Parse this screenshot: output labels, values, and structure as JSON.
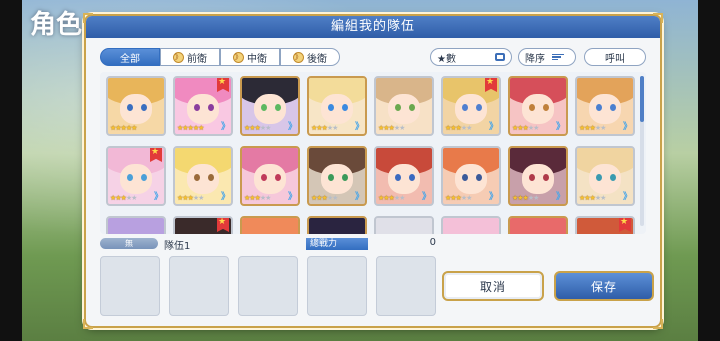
{
  "background": {
    "title_fragment": "角色"
  },
  "dialog": {
    "title": "編組我的隊伍"
  },
  "filters": {
    "tabs": [
      {
        "label": "全部",
        "active": true,
        "icon": ""
      },
      {
        "label": "前衛",
        "active": false,
        "icon": "position-icon"
      },
      {
        "label": "中衛",
        "active": false,
        "icon": "position-icon"
      },
      {
        "label": "後衛",
        "active": false,
        "icon": "position-icon"
      }
    ],
    "sort_field": "★數",
    "sort_order": "降序",
    "call_label": "呼叫"
  },
  "roster": {
    "rows": [
      [
        {
          "stars": 5,
          "fav": false,
          "rank": "",
          "hair": "#e8b55a",
          "eye": "#3a6ec0",
          "bg": "#f6d8a6"
        },
        {
          "stars": 5,
          "fav": true,
          "rank": "》",
          "hair": "#f08ac0",
          "eye": "#8a3d9e",
          "bg": "#f9c8e2"
        },
        {
          "stars": 3,
          "fav": false,
          "rank": "》",
          "hair": "#2c2a36",
          "eye": "#5cb860",
          "bg": "#d8c6e8"
        },
        {
          "stars": 3,
          "fav": false,
          "rank": "》",
          "hair": "#f3dc9a",
          "eye": "#3a8ae0",
          "bg": "#f7e5c6"
        },
        {
          "stars": 3,
          "fav": false,
          "rank": "",
          "hair": "#d9b58a",
          "eye": "#6aa84f",
          "bg": "#f7e1c6"
        },
        {
          "stars": 3,
          "fav": true,
          "rank": "》",
          "hair": "#e8c46a",
          "eye": "#4f7fd0",
          "bg": "#f2d4a4"
        },
        {
          "stars": 3,
          "fav": false,
          "rank": "》",
          "hair": "#d64f5a",
          "eye": "#c0803a",
          "bg": "#f6c4c4"
        },
        {
          "stars": 3,
          "fav": false,
          "rank": "》",
          "hair": "#e3a35a",
          "eye": "#4a7fd0",
          "bg": "#f7d6b0"
        }
      ],
      [
        {
          "stars": 3,
          "fav": true,
          "rank": "》",
          "hair": "#f2b8d6",
          "eye": "#4aa0d8",
          "bg": "#f6d2e6"
        },
        {
          "stars": 3,
          "fav": false,
          "rank": "》",
          "hair": "#f4d870",
          "eye": "#9a6a3a",
          "bg": "#fbe8b0"
        },
        {
          "stars": 3,
          "fav": false,
          "rank": "》",
          "hair": "#e47aa4",
          "eye": "#c03a5a",
          "bg": "#f6c8da"
        },
        {
          "stars": 3,
          "fav": false,
          "rank": "》",
          "hair": "#6a4a3a",
          "eye": "#3a9a5a",
          "bg": "#d4c6b6"
        },
        {
          "stars": 3,
          "fav": false,
          "rank": "》",
          "hair": "#c84a3a",
          "eye": "#3a6ac0",
          "bg": "#f2bcb0"
        },
        {
          "stars": 3,
          "fav": false,
          "rank": "》",
          "hair": "#e87a4a",
          "eye": "#3a5a9a",
          "bg": "#f6ccb4"
        },
        {
          "stars": 3,
          "fav": false,
          "rank": "》",
          "hair": "#5a2a3a",
          "eye": "#b03a4a",
          "bg": "#c8a0aa"
        },
        {
          "stars": 3,
          "fav": false,
          "rank": "》",
          "hair": "#f0d4a0",
          "eye": "#3a9ab0",
          "bg": "#f4e2c4"
        }
      ],
      [
        {
          "stars": 3,
          "fav": false,
          "rank": "",
          "hair": "#b8a0e0",
          "eye": "#5a4aa0",
          "bg": "#dcd0f0"
        },
        {
          "stars": 3,
          "fav": true,
          "rank": "",
          "hair": "#3a2a2a",
          "eye": "#8a3a3a",
          "bg": "#c8a8a0"
        },
        {
          "stars": 3,
          "fav": false,
          "rank": "",
          "hair": "#f08a5a",
          "eye": "#3a5a9a",
          "bg": "#f6c8b0"
        },
        {
          "stars": 3,
          "fav": false,
          "rank": "",
          "hair": "#2a2440",
          "eye": "#8a6ad0",
          "bg": "#c0b4d8"
        },
        {
          "stars": 3,
          "fav": false,
          "rank": "",
          "hair": "#e0e0e8",
          "eye": "#6a8ac0",
          "bg": "#eceef4"
        },
        {
          "stars": 3,
          "fav": false,
          "rank": "",
          "hair": "#f4c0d8",
          "eye": "#c04a8a",
          "bg": "#f8dcea"
        },
        {
          "stars": 3,
          "fav": false,
          "rank": "",
          "hair": "#e86a6a",
          "eye": "#3a6ac0",
          "bg": "#f6c0c0"
        },
        {
          "stars": 3,
          "fav": true,
          "rank": "",
          "hair": "#d05a3a",
          "eye": "#5a3a2a",
          "bg": "#f2c0a8"
        }
      ]
    ]
  },
  "team": {
    "weapon_tag": "無",
    "name": "隊伍1",
    "power_label": "總戰力",
    "power_value": "0",
    "slots": 5
  },
  "buttons": {
    "cancel": "取消",
    "save": "保存"
  },
  "colors": {
    "accent": "#336ec0",
    "gold": "#c9a24a",
    "favorite": "#e23a3a",
    "star": "#f5c030"
  }
}
